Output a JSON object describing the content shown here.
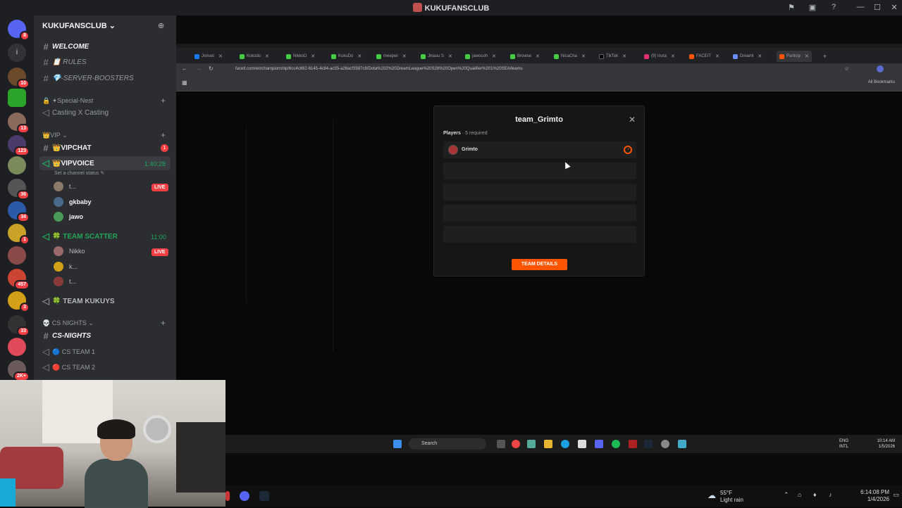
{
  "window": {
    "title": "KUKUFANSCLUB"
  },
  "server": {
    "name": "KUKUFANSCLUB"
  },
  "rail_badges": [
    "8",
    "10",
    "13",
    "123",
    "36",
    "34",
    "1",
    "457",
    "3",
    "33",
    "2K+"
  ],
  "channels": {
    "welcome": "WELCOME",
    "rules": "📋 RULES",
    "boosters": "💎-SERVER-BOOSTERS",
    "cat_special": "🔒 ✦Special-Nest",
    "casting": "Casting X Casting",
    "cat_vip": "👑VIP",
    "vipchat": "👑VIPCHAT",
    "vipchat_badge": "1",
    "vipvoice": "👑VIPVOICE",
    "vipvoice_timer": "1:40:28",
    "vipvoice_status": "Set a channel status",
    "vip_users": [
      "t...",
      "gkbaby",
      "jawo"
    ],
    "team_scatter": "🍀 TEAM SCATTER",
    "team_scatter_timer": "11:00",
    "scatter_users": [
      "Nikko",
      "k...",
      "t..."
    ],
    "team_kukuys": "🍀 TEAM KUKUYS",
    "cat_cs": "💀 CS NIGHTS",
    "cs_nights": "CS-NIGHTS",
    "cs_team1": "🔵 CS TEAM 1",
    "cs_team2": "🔴 CS TEAM 2",
    "live_label": "LIVE"
  },
  "browser": {
    "tabs": [
      "Jomari",
      "Kokzdo",
      "NikkoD",
      "KukuDo",
      "meepwi",
      "Jinasu S",
      "jawocoh",
      "Browse",
      "NicaCha",
      "TikTok",
      "(9) Insta",
      "FACEIT",
      "Dreaml",
      "Particip"
    ],
    "url": "faceit.com/en/championship/6cc4c692-6145-4c84-ac55-a26acf3587c8/Dota%202%20DreamLeague%20S28%20Open%20Qualifier%201%20SEA/teams",
    "all_bookmarks": "All Bookmarks"
  },
  "modal": {
    "title": "team_Grimto",
    "players_label": "Players",
    "required": "· 5 required",
    "player1": "Grimto",
    "button": "TEAM DETAILS"
  },
  "inner_taskbar": {
    "search": "Search",
    "lang1": "ENG",
    "lang2": "INTL",
    "time": "10:14 AM",
    "date": "1/5/2026"
  },
  "outer_taskbar": {
    "temp": "55°F",
    "weather": "Light rain",
    "time": "6:14:08 PM",
    "date": "1/4/2026"
  },
  "colors": {
    "accent": "#ff5500",
    "live": "#f23f43",
    "voice_green": "#23a55a"
  }
}
